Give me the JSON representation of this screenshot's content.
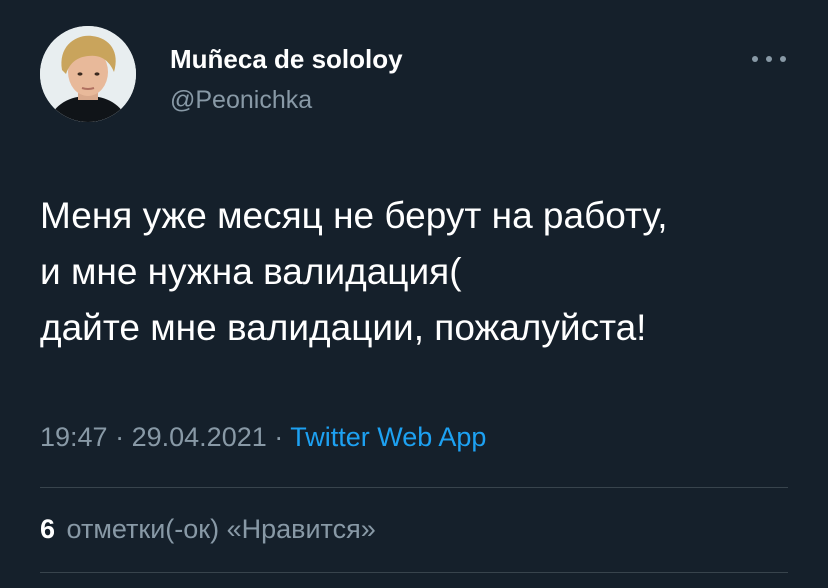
{
  "user": {
    "display_name": "Muñeca de sololoy",
    "handle": "@Peonichka",
    "avatar_icon": "person-avatar"
  },
  "menu": {
    "more_icon": "more-horizontal-icon"
  },
  "tweet": {
    "lines": [
      "Меня уже месяц не берут на работу,",
      "и мне нужна валидация(",
      "дайте мне валидации, пожалуйста!"
    ]
  },
  "meta": {
    "time": "19:47",
    "separator": "·",
    "date": "29.04.2021",
    "app": "Twitter Web App"
  },
  "stats": {
    "likes_count": "6",
    "likes_label": "отметки(-ок) «Нравится»"
  },
  "colors": {
    "background": "#15202b",
    "text": "#ffffff",
    "secondary": "#8899a6",
    "accent": "#1da1f2",
    "divider": "#38444d"
  }
}
